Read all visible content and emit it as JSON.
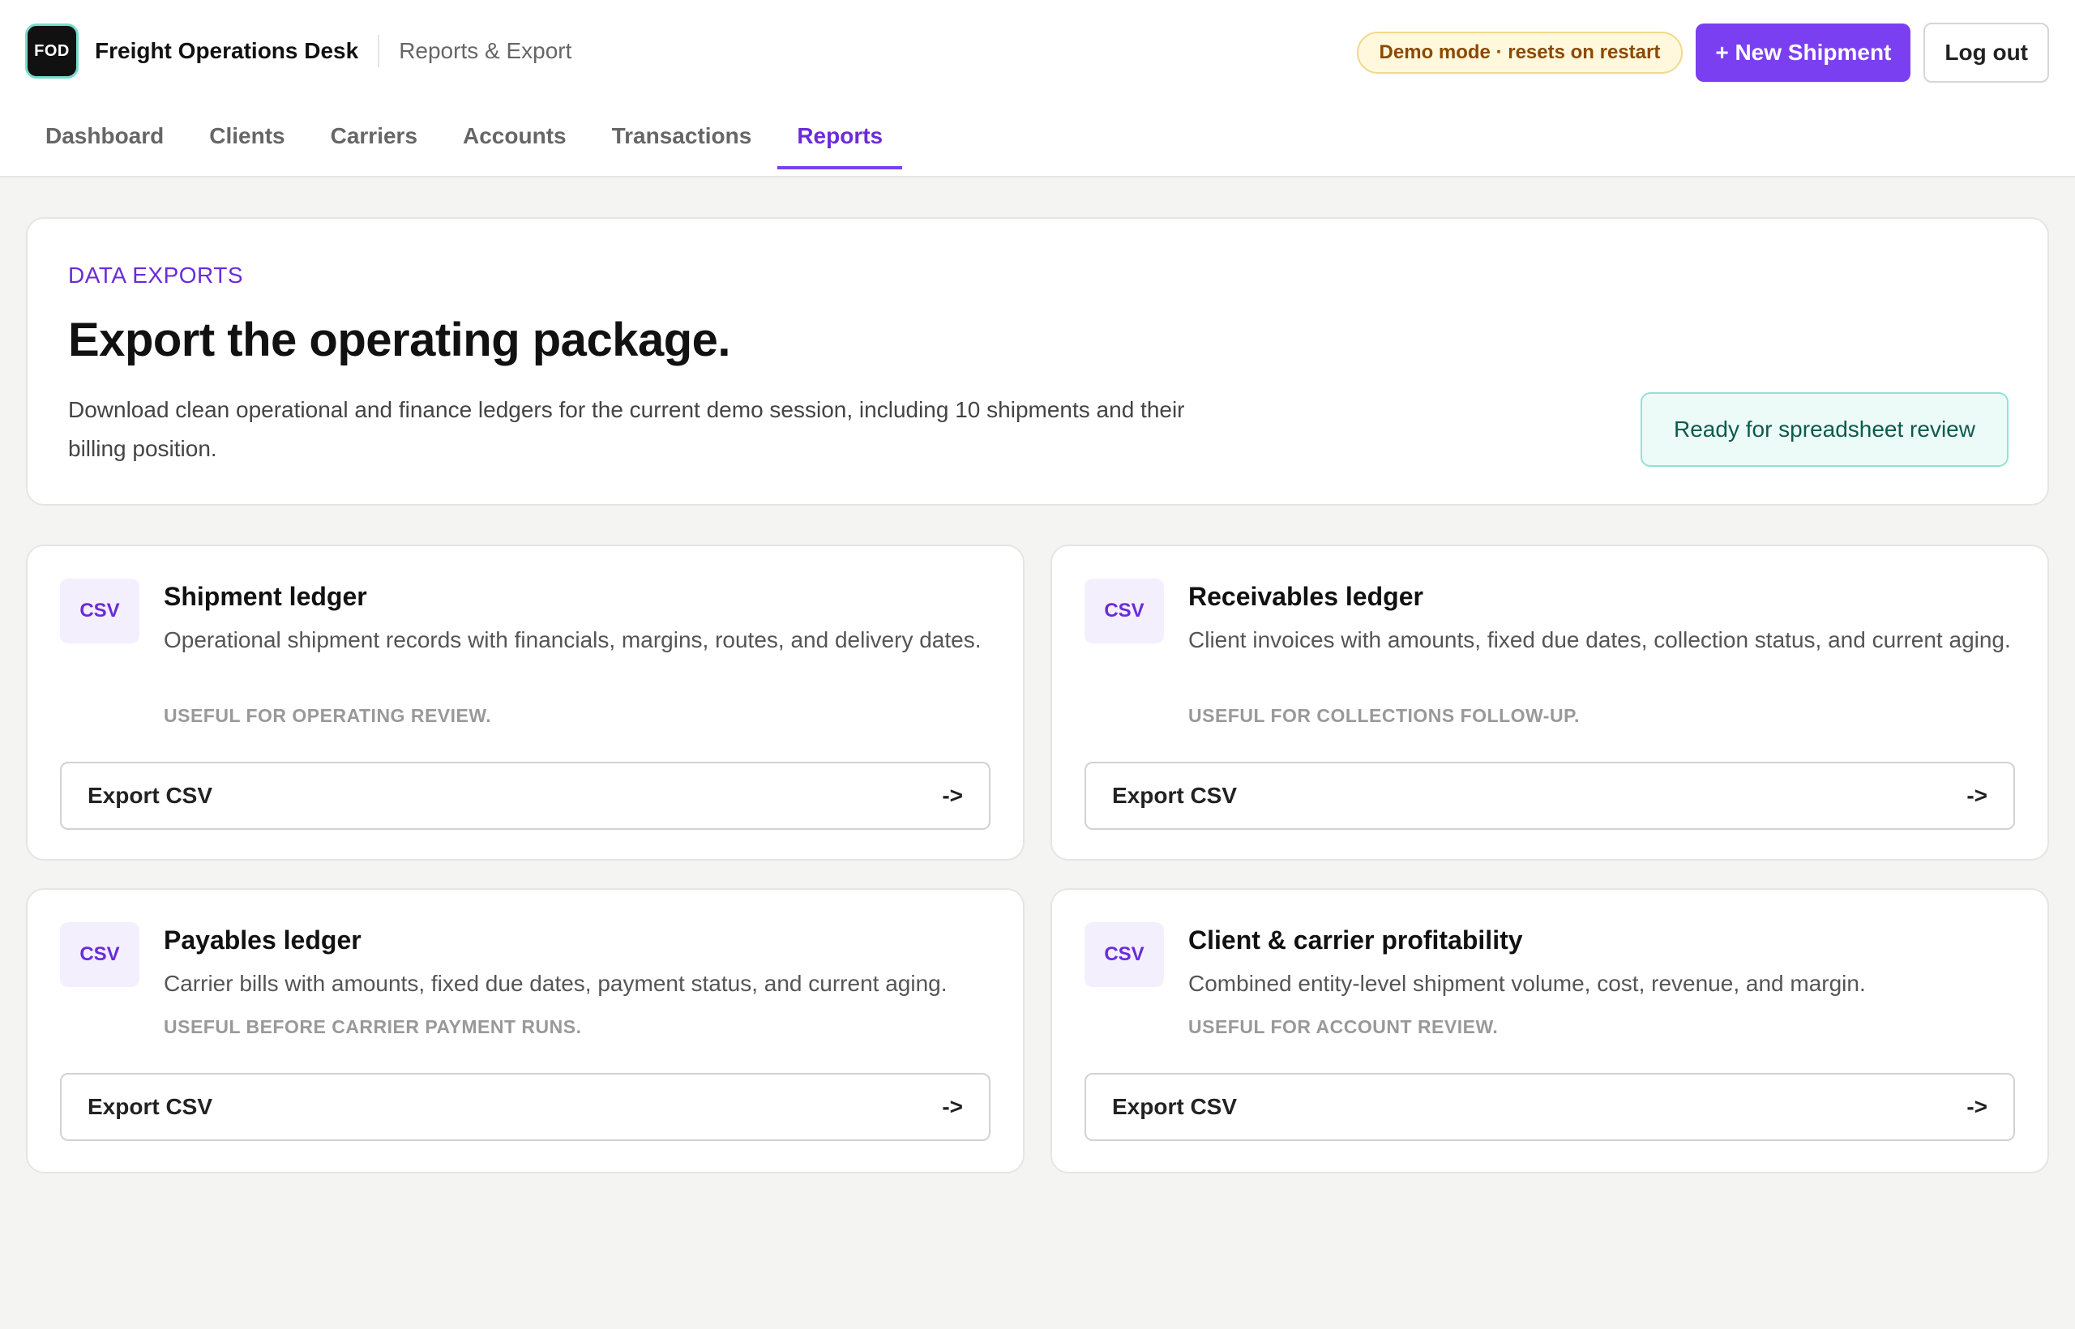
{
  "header": {
    "logo_text": "FOD",
    "app_title": "Freight Operations Desk",
    "section_title": "Reports & Export",
    "demo_badge": "Demo mode · resets on restart",
    "new_shipment_label": "+ New Shipment",
    "logout_label": "Log out"
  },
  "tabs": [
    {
      "label": "Dashboard",
      "active": false
    },
    {
      "label": "Clients",
      "active": false
    },
    {
      "label": "Carriers",
      "active": false
    },
    {
      "label": "Accounts",
      "active": false
    },
    {
      "label": "Transactions",
      "active": false
    },
    {
      "label": "Reports",
      "active": true
    }
  ],
  "hero": {
    "eyebrow": "DATA EXPORTS",
    "title": "Export the operating package.",
    "description": "Download clean operational and finance ledgers for the current demo session, including 10 shipments and their billing position.",
    "ready_label": "Ready for spreadsheet review"
  },
  "cards": [
    {
      "tag": "CSV",
      "title": "Shipment ledger",
      "description": "Operational shipment records with financials, margins, routes, and delivery dates.",
      "note": "USEFUL FOR OPERATING REVIEW.",
      "button_label": "Export CSV",
      "arrow": "->"
    },
    {
      "tag": "CSV",
      "title": "Receivables ledger",
      "description": "Client invoices with amounts, fixed due dates, collection status, and current aging.",
      "note": "USEFUL FOR COLLECTIONS FOLLOW-UP.",
      "button_label": "Export CSV",
      "arrow": "->"
    },
    {
      "tag": "CSV",
      "title": "Payables ledger",
      "description": "Carrier bills with amounts, fixed due dates, payment status, and current aging.",
      "note": "USEFUL BEFORE CARRIER PAYMENT RUNS.",
      "button_label": "Export CSV",
      "arrow": "->"
    },
    {
      "tag": "CSV",
      "title": "Client & carrier profitability",
      "description": "Combined entity-level shipment volume, cost, revenue, and margin.",
      "note": "USEFUL FOR ACCOUNT REVIEW.",
      "button_label": "Export CSV",
      "arrow": "->"
    }
  ],
  "colors": {
    "accent": "#7b3ff2",
    "accent_text": "#6b2bd9",
    "ready_bg": "#ecfbf7",
    "ready_border": "#8fe3d3",
    "demo_bg": "#fff8dd"
  }
}
